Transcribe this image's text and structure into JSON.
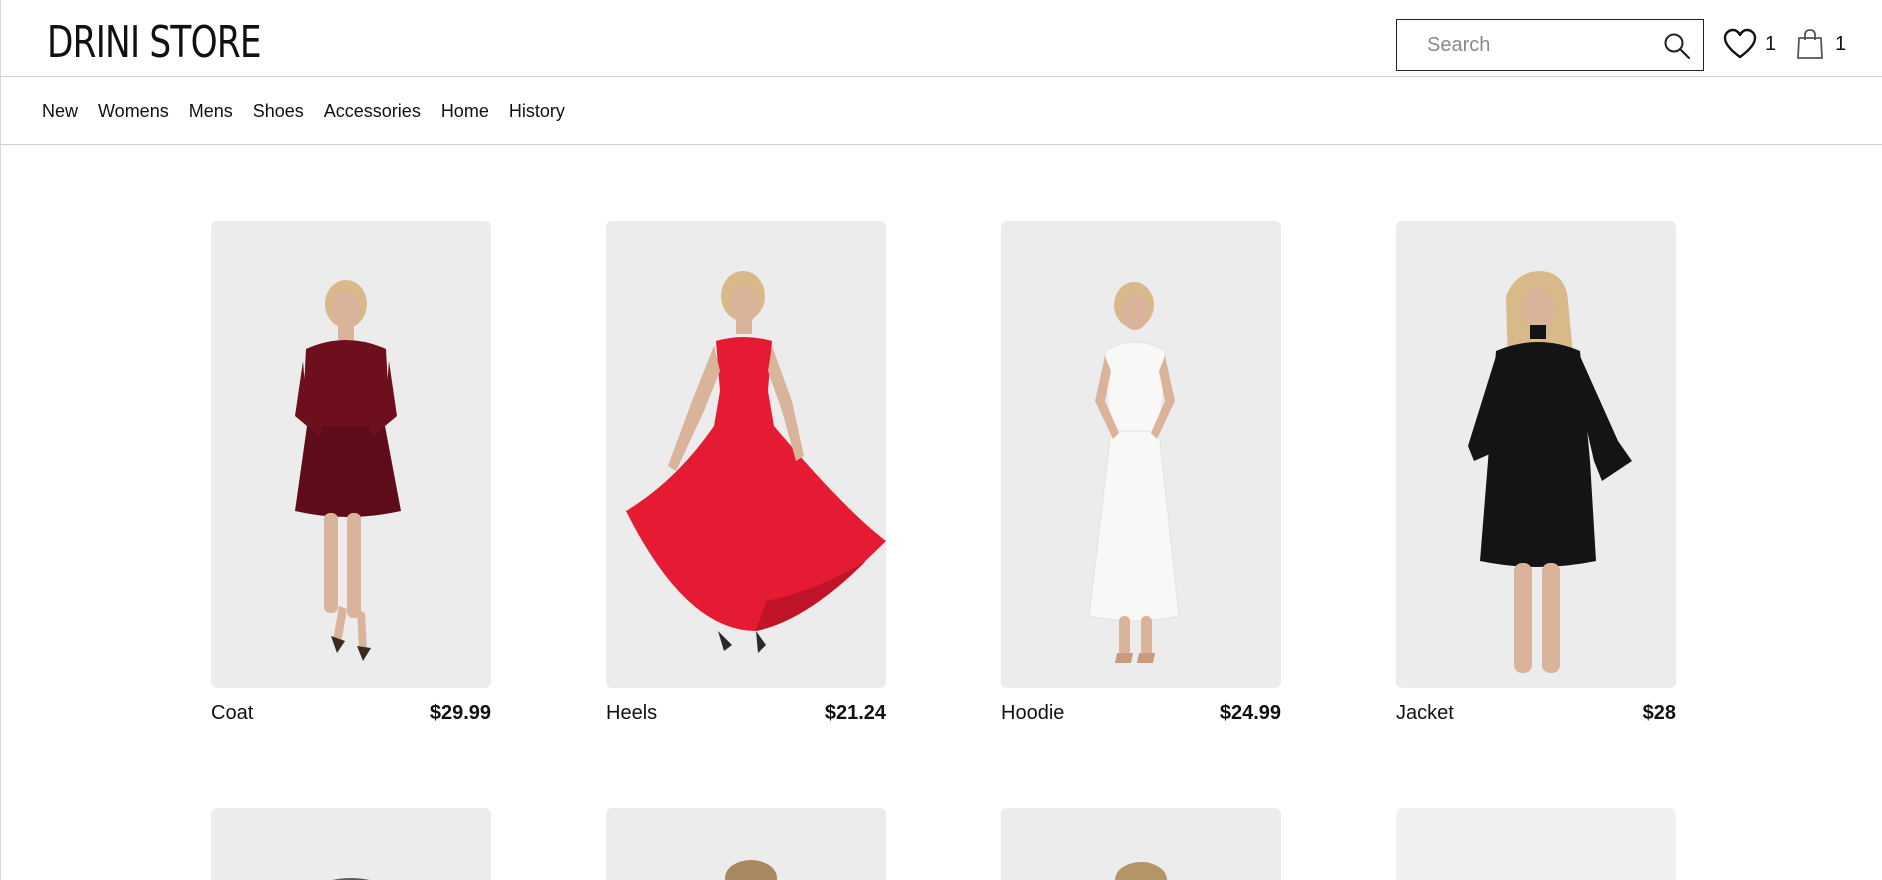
{
  "header": {
    "logo": "DRINI STORE",
    "search_placeholder": "Search",
    "wishlist_count": "1",
    "cart_count": "1"
  },
  "nav": [
    "New",
    "Womens",
    "Mens",
    "Shoes",
    "Accessories",
    "Home",
    "History"
  ],
  "products": [
    {
      "name": "Coat",
      "price": "$29.99",
      "dress_color": "#6e0f1e"
    },
    {
      "name": "Heels",
      "price": "$21.24",
      "dress_color": "#e41b33"
    },
    {
      "name": "Hoodie",
      "price": "$24.99",
      "dress_color": "#f8f8f6"
    },
    {
      "name": "Jacket",
      "price": "$28",
      "dress_color": "#141414"
    }
  ],
  "colors": {
    "skin": "#d9b39a",
    "hair": "#d8b98a",
    "photo_bg": "#ececec"
  }
}
